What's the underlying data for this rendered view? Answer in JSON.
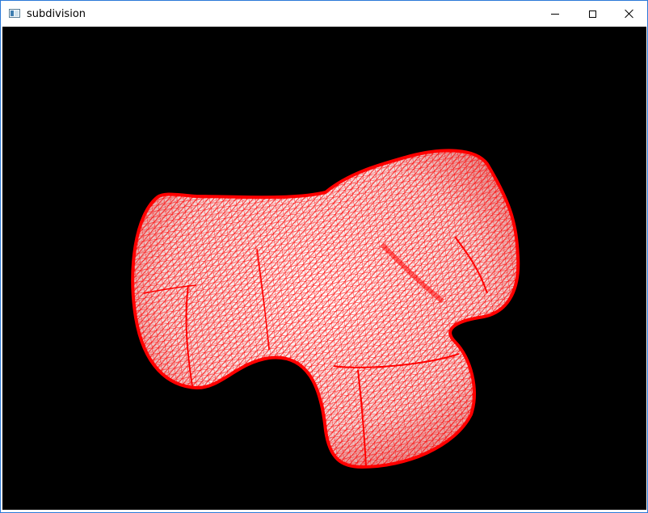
{
  "window": {
    "title": "subdivision",
    "icon": "application-window-icon",
    "controls": {
      "minimize_icon": "minimize-icon",
      "maximize_icon": "maximize-icon",
      "close_icon": "close-icon"
    }
  },
  "viewport": {
    "background_color": "#000000",
    "mesh": {
      "render_mode": "wireframe",
      "wire_color": "#ff0000",
      "fill_color": "#ffffff",
      "element": "triangles"
    }
  }
}
